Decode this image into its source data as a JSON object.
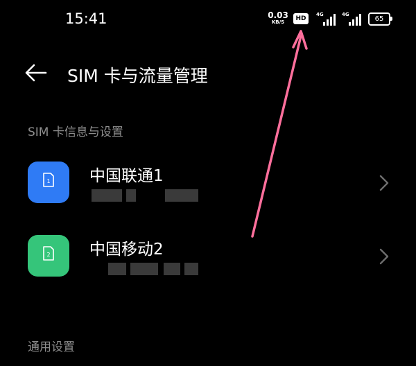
{
  "status_bar": {
    "time": "15:41",
    "net_speed_value": "0.03",
    "net_speed_unit": "KB/S",
    "hd_badge": "HD",
    "signal_1_label": "4G",
    "signal_2_label": "4G",
    "battery_level": "65"
  },
  "header": {
    "back_icon": "back-arrow-icon",
    "title": "SIM 卡与流量管理"
  },
  "sections": {
    "sim_info_title": "SIM 卡信息与设置",
    "general_title": "通用设置"
  },
  "sims": [
    {
      "name": "中国联通1",
      "slot": "1",
      "color": "#2f7bf5",
      "icon": "sim-card-icon"
    },
    {
      "name": "中国移动2",
      "slot": "2",
      "color": "#35c57a",
      "icon": "sim-card-icon"
    }
  ],
  "annotation": {
    "color": "#ff6f9c"
  }
}
